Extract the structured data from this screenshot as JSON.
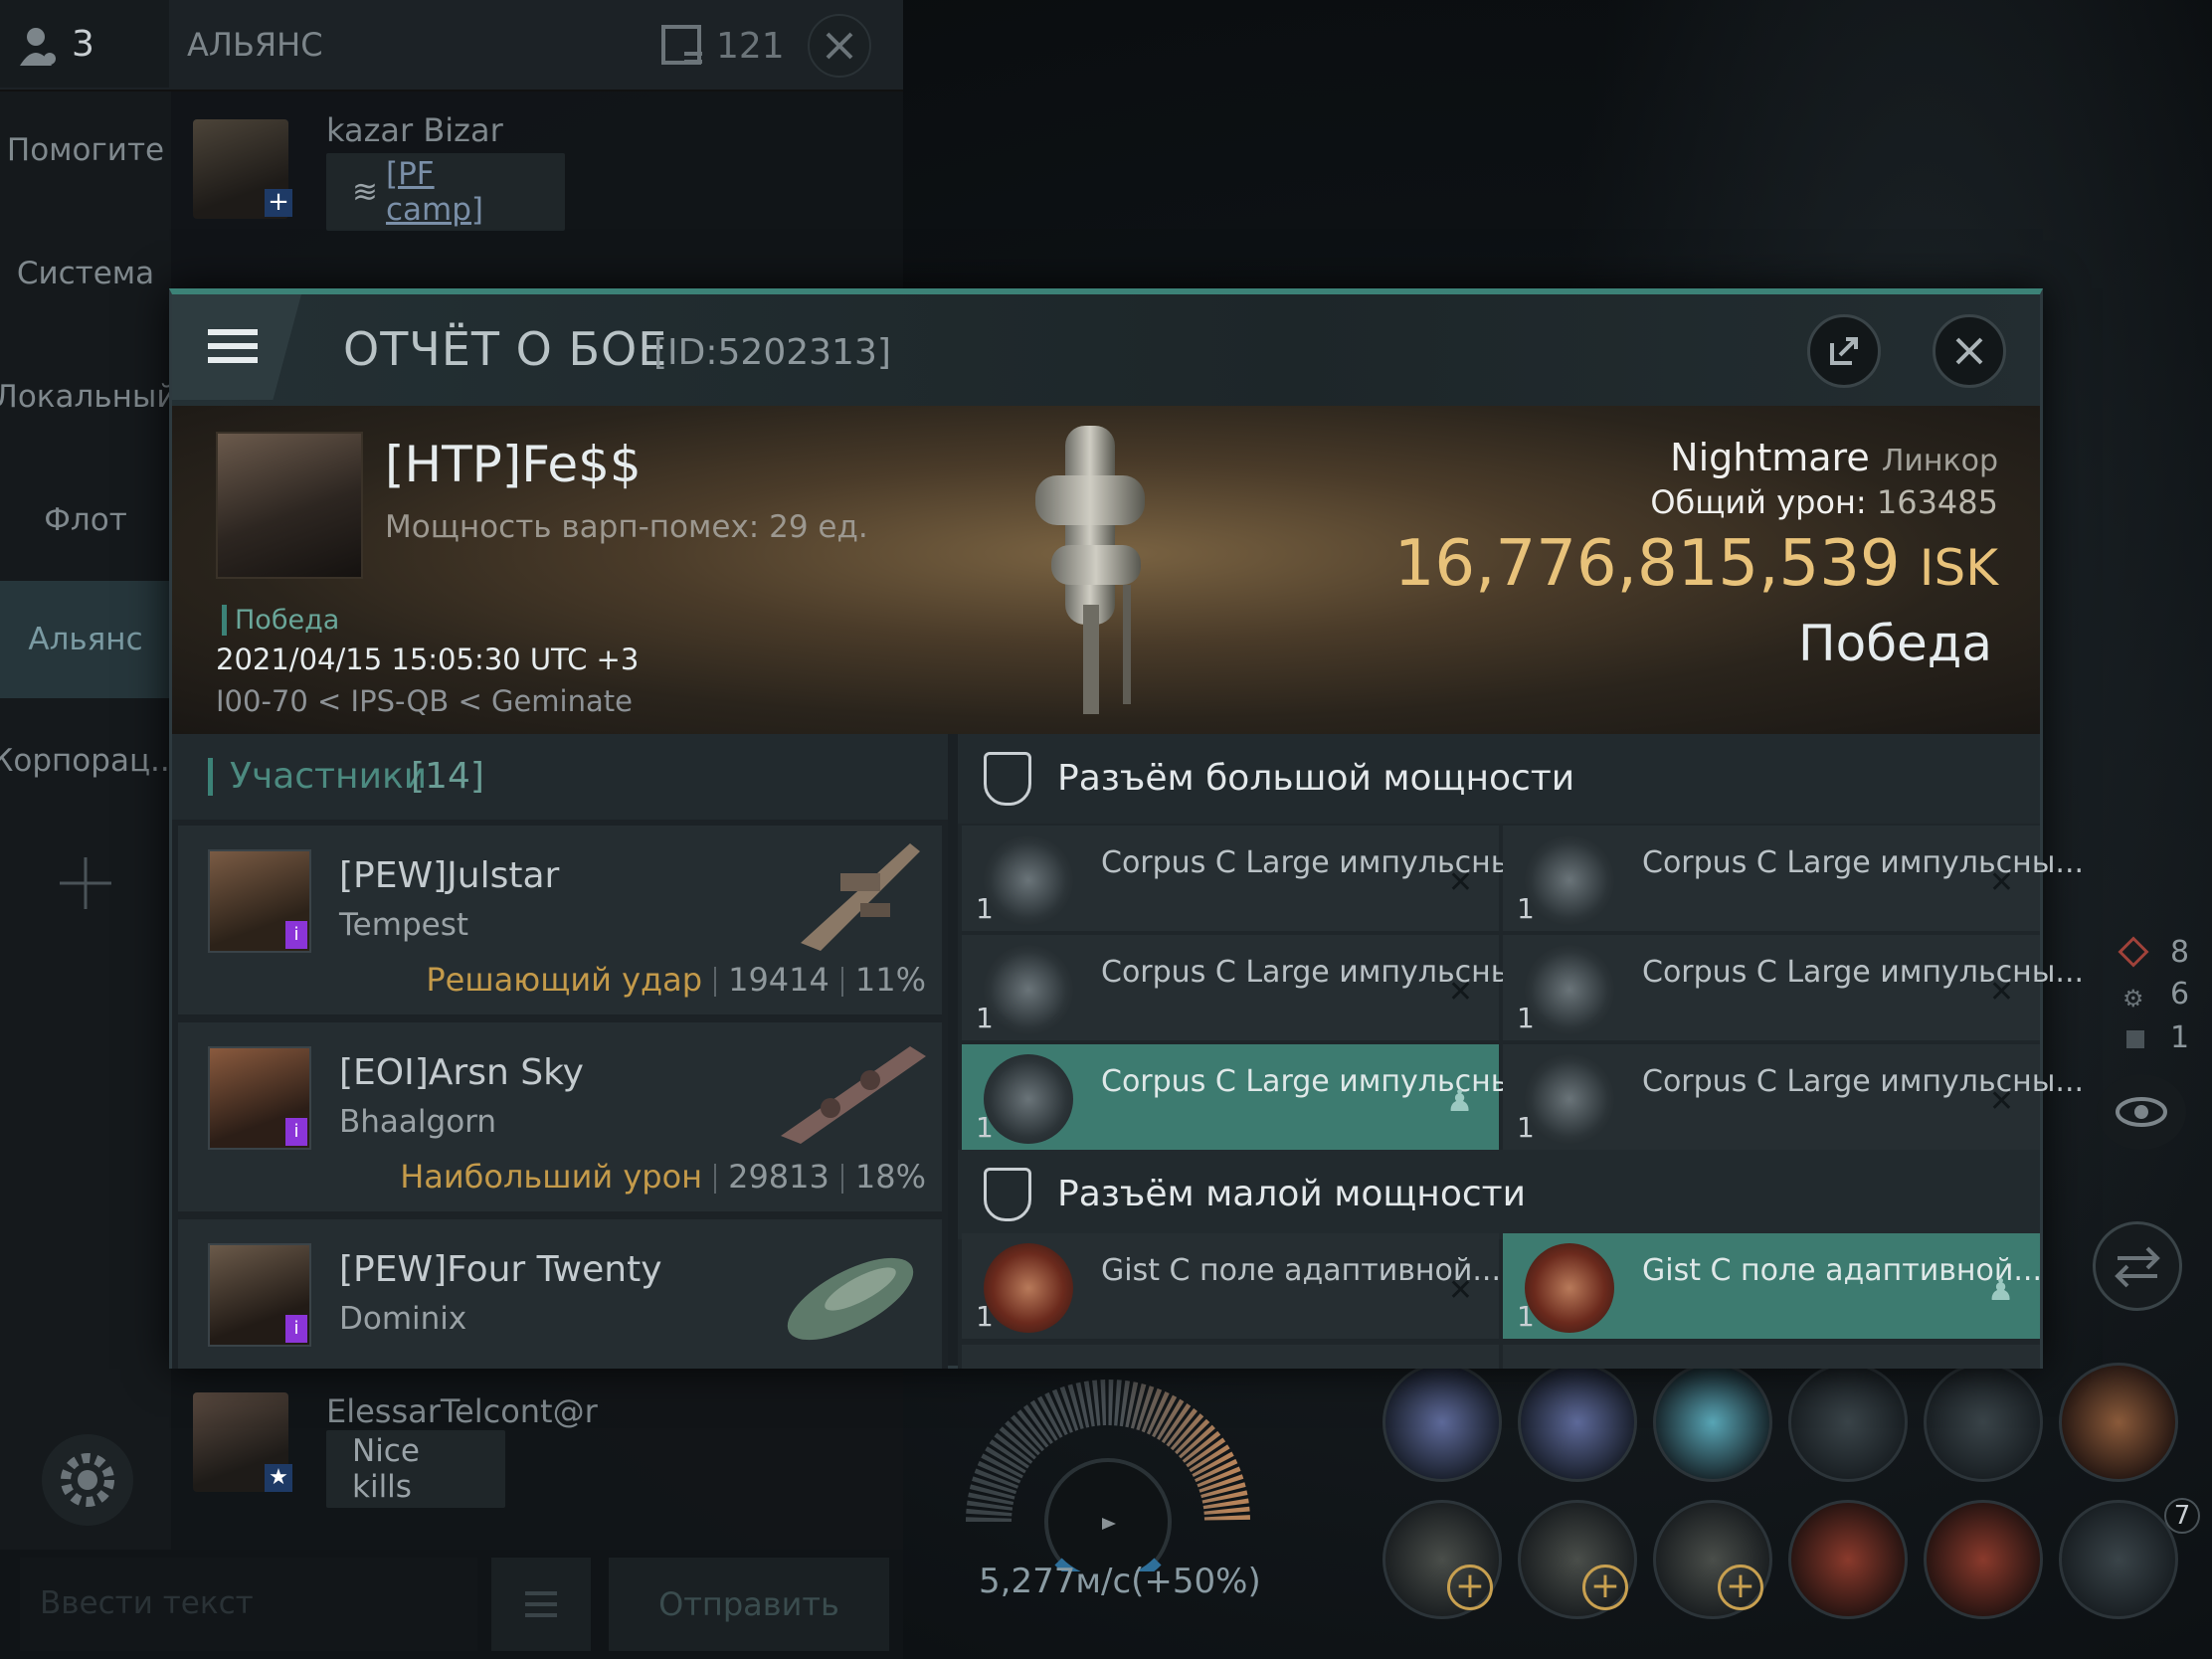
{
  "chat": {
    "member_count": "3",
    "title": "АЛЬЯНС",
    "message_count": "121",
    "channels": [
      "Помогите",
      "Система",
      "Локальный",
      "Флот",
      "Альянс",
      "Корпорац..."
    ],
    "messages": [
      {
        "author": "kazar Bizar",
        "text": "[PF camp]"
      },
      {
        "author": "ElessarTelcont@r",
        "text": "Nice kills"
      }
    ],
    "input_placeholder": "Ввести текст",
    "send_label": "Отправить"
  },
  "report": {
    "title": "ОТЧЁТ О БОЕ",
    "id": "[ID:5202313]",
    "pilot": "[HTP]Fe$$",
    "warp_strength": "Мощность варп-помех: 29 ед.",
    "result_tag": "Победа",
    "datetime": "2021/04/15 15:05:30 UTC +3",
    "location": "I00-70 < IPS-QB < Geminate",
    "ship_name": "Nightmare",
    "ship_class": "Линкор",
    "total_damage_label": "Общий урон:",
    "total_damage": "163485",
    "isk_value": "16,776,815,539",
    "isk_unit": "ISK",
    "result_big": "Победа",
    "participants_label": "Участники",
    "participants_count": "[14]",
    "participants": [
      {
        "name": "[PEW]Julstar",
        "ship": "Tempest",
        "tag": "Решающий удар",
        "damage": "19414",
        "percent": "11%"
      },
      {
        "name": "[EOI]Arsn Sky",
        "ship": "Bhaalgorn",
        "tag": "Наибольший урон",
        "damage": "29813",
        "percent": "18%"
      },
      {
        "name": "[PEW]Four Twenty",
        "ship": "Dominix",
        "tag": "",
        "damage": "",
        "percent": ""
      }
    ],
    "high_slots_label": "Разъём большой мощности",
    "high_slots": [
      {
        "name": "Corpus C Large импульсны...",
        "qty": "1",
        "state": "destroyed"
      },
      {
        "name": "Corpus C Large импульсны...",
        "qty": "1",
        "state": "destroyed"
      },
      {
        "name": "Corpus C Large импульсны...",
        "qty": "1",
        "state": "destroyed"
      },
      {
        "name": "Corpus C Large импульсны...",
        "qty": "1",
        "state": "destroyed"
      },
      {
        "name": "Corpus C Large импульсны...",
        "qty": "1",
        "state": "dropped"
      },
      {
        "name": "Corpus C Large импульсны...",
        "qty": "1",
        "state": "destroyed"
      }
    ],
    "low_slots_label": "Разъём малой мощности",
    "low_slots": [
      {
        "name": "Gist C поле адаптивной...",
        "qty": "1",
        "state": "destroyed"
      },
      {
        "name": "Gist C поле адаптивной...",
        "qty": "1",
        "state": "dropped"
      }
    ]
  },
  "hud": {
    "speed": "5,277м/с(+50%)",
    "counters": [
      "8",
      "6",
      "1"
    ],
    "drone_count": "7"
  },
  "colors": {
    "accent_teal": "#3c8277",
    "isk_gold": "#e8c27a",
    "tag_gold": "#c49a4a",
    "selected_slot": "#3d7b70",
    "badge_purple": "#8b35d8"
  }
}
